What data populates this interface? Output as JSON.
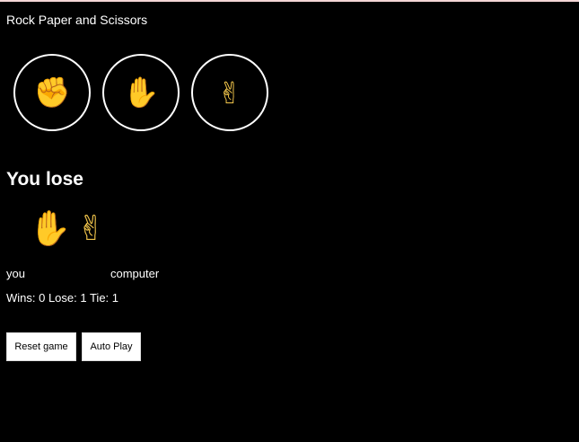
{
  "app": {
    "title": "Rock Paper and Scissors"
  },
  "choices": [
    {
      "name": "rock",
      "icon": "✊",
      "icon_name": "rock-fist-icon"
    },
    {
      "name": "paper",
      "icon": "✋",
      "icon_name": "paper-hand-icon"
    },
    {
      "name": "scissors",
      "icon": "✌",
      "icon_name": "scissors-hand-icon"
    }
  ],
  "result": {
    "text": "You lose",
    "player_move_icon": "✋",
    "computer_move_icon": "✌"
  },
  "labels": {
    "you": "you",
    "computer": "computer"
  },
  "score": {
    "text": "Wins: 0 Lose: 1 Tie: 1"
  },
  "actions": {
    "reset_label": "Reset game",
    "autoplay_label": "Auto Play"
  },
  "colors": {
    "background": "#000000",
    "text": "#ffffff",
    "emoji": "#f5c84c"
  }
}
